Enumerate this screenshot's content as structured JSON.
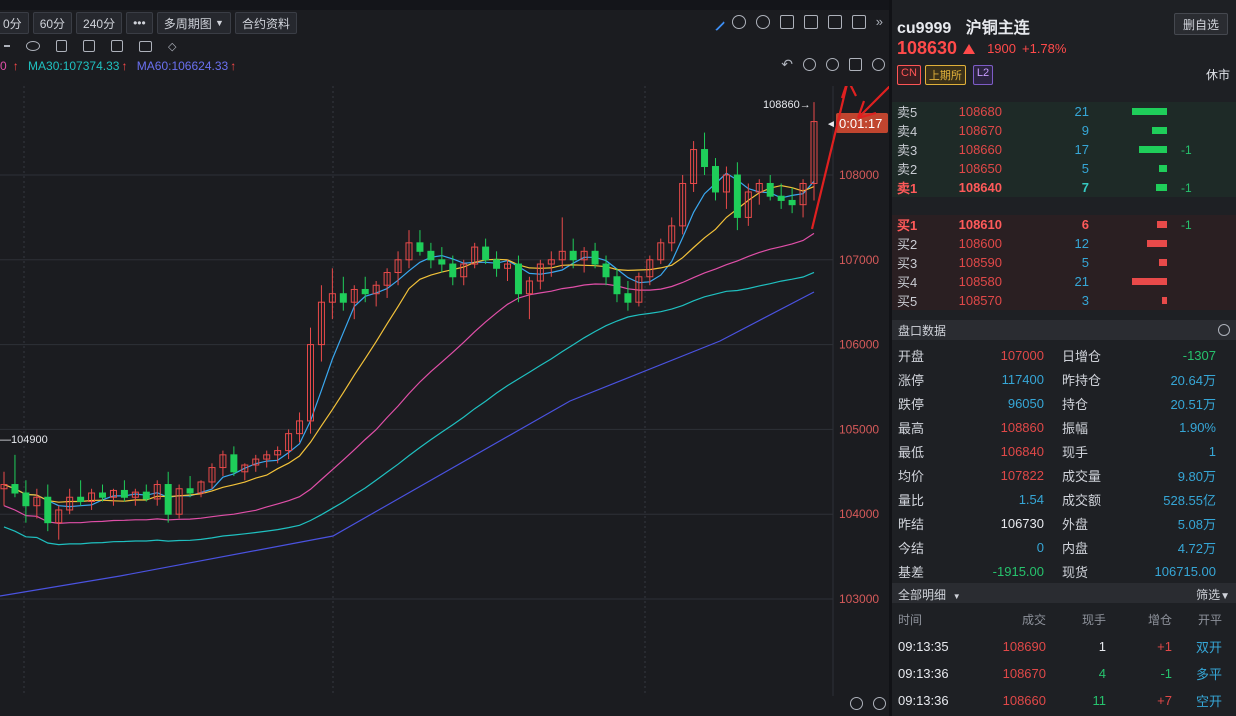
{
  "toolbar": {
    "periods": [
      "0分",
      "60分",
      "240分"
    ],
    "more": "•••",
    "multi_period": "多周期图",
    "contract_info": "合约资料"
  },
  "ma": {
    "ma_prefix": "0",
    "ma30": "MA30:107374.33",
    "ma60": "MA60:106624.33"
  },
  "chart": {
    "price_ticks": [
      "108000",
      "107000",
      "106000",
      "105000",
      "104000",
      "103000"
    ],
    "high_label": "108860",
    "low_label": "104900",
    "countdown": "0:01:17"
  },
  "chart_data": {
    "type": "candlestick",
    "ylim": [
      102000,
      109000
    ],
    "current_price": 108630,
    "high": 108860,
    "low_marker": 104900,
    "colors": {
      "up": "#e84a4a",
      "down": "#1fce5a",
      "ma5": "#3aa8f0",
      "ma10": "#f3c23a",
      "ma20": "#e04fa8",
      "ma30": "#1fc0c0",
      "ma60": "#4a52e0"
    }
  },
  "panel": {
    "symbol": "cu9999",
    "name": "沪铜主连",
    "delete_btn": "删自选",
    "price": "108630",
    "change": "1900",
    "change_pct": "+1.78%",
    "tag_cn": "CN",
    "tag_exchange": "上期所",
    "tag_l2": "L2",
    "status": "休市"
  },
  "sell_orders": [
    {
      "label": "卖5",
      "price": "108680",
      "vol": "21",
      "bar": 0.58,
      "delta": ""
    },
    {
      "label": "卖4",
      "price": "108670",
      "vol": "9",
      "bar": 0.25,
      "delta": ""
    },
    {
      "label": "卖3",
      "price": "108660",
      "vol": "17",
      "bar": 0.47,
      "delta": "-1"
    },
    {
      "label": "卖2",
      "price": "108650",
      "vol": "5",
      "bar": 0.14,
      "delta": ""
    },
    {
      "label": "卖1",
      "price": "108640",
      "vol": "7",
      "bar": 0.19,
      "delta": "-1"
    }
  ],
  "buy_orders": [
    {
      "label": "买1",
      "price": "108610",
      "vol": "6",
      "bar": 0.17,
      "delta": "-1"
    },
    {
      "label": "买2",
      "price": "108600",
      "vol": "12",
      "bar": 0.33,
      "delta": ""
    },
    {
      "label": "买3",
      "price": "108590",
      "vol": "5",
      "bar": 0.14,
      "delta": ""
    },
    {
      "label": "买4",
      "price": "108580",
      "vol": "21",
      "bar": 0.58,
      "delta": ""
    },
    {
      "label": "买5",
      "price": "108570",
      "vol": "3",
      "bar": 0.08,
      "delta": ""
    }
  ],
  "quote_head": "盘口数据",
  "quote": [
    {
      "k": "开盘",
      "v": "107000",
      "vc": "c-red",
      "k2": "日增仓",
      "v2": "-1307",
      "v2c": "c-green"
    },
    {
      "k": "涨停",
      "v": "117400",
      "vc": "c-blue",
      "k2": "昨持仓",
      "v2": "20.64万",
      "v2c": "c-blue"
    },
    {
      "k": "跌停",
      "v": "96050",
      "vc": "c-blue",
      "k2": "持仓",
      "v2": "20.51万",
      "v2c": "c-blue"
    },
    {
      "k": "最高",
      "v": "108860",
      "vc": "c-red",
      "k2": "振幅",
      "v2": "1.90%",
      "v2c": "c-blue"
    },
    {
      "k": "最低",
      "v": "106840",
      "vc": "c-red",
      "k2": "现手",
      "v2": "1",
      "v2c": "c-blue"
    },
    {
      "k": "均价",
      "v": "107822",
      "vc": "c-red",
      "k2": "成交量",
      "v2": "9.80万",
      "v2c": "c-blue"
    },
    {
      "k": "量比",
      "v": "1.54",
      "vc": "c-blue",
      "k2": "成交额",
      "v2": "528.55亿",
      "v2c": "c-blue"
    },
    {
      "k": "昨结",
      "v": "106730",
      "vc": "c-white",
      "k2": "外盘",
      "v2": "5.08万",
      "v2c": "c-blue"
    },
    {
      "k": "今结",
      "v": "0",
      "vc": "c-blue",
      "k2": "内盘",
      "v2": "4.72万",
      "v2c": "c-blue"
    },
    {
      "k": "基差",
      "v": "-1915.00",
      "vc": "c-green",
      "k2": "现货",
      "v2": "106715.00",
      "v2c": "c-blue"
    }
  ],
  "trades_head": {
    "title": "全部明细",
    "filter": "筛选"
  },
  "trades_cols": [
    "时间",
    "成交",
    "现手",
    "增仓",
    "开平"
  ],
  "trades": [
    {
      "time": "09:13:35",
      "price": "108690",
      "vol": "1",
      "volc": "c-white",
      "oi": "+1",
      "oic": "c-red",
      "type": "双开",
      "typec": "c-blue"
    },
    {
      "time": "09:13:36",
      "price": "108670",
      "vol": "4",
      "volc": "c-green",
      "oi": "-1",
      "oic": "c-green",
      "type": "多平",
      "typec": "c-blue"
    },
    {
      "time": "09:13:36",
      "price": "108660",
      "vol": "11",
      "volc": "c-green",
      "oi": "+7",
      "oic": "c-red",
      "type": "空开",
      "typec": "c-blue"
    }
  ]
}
